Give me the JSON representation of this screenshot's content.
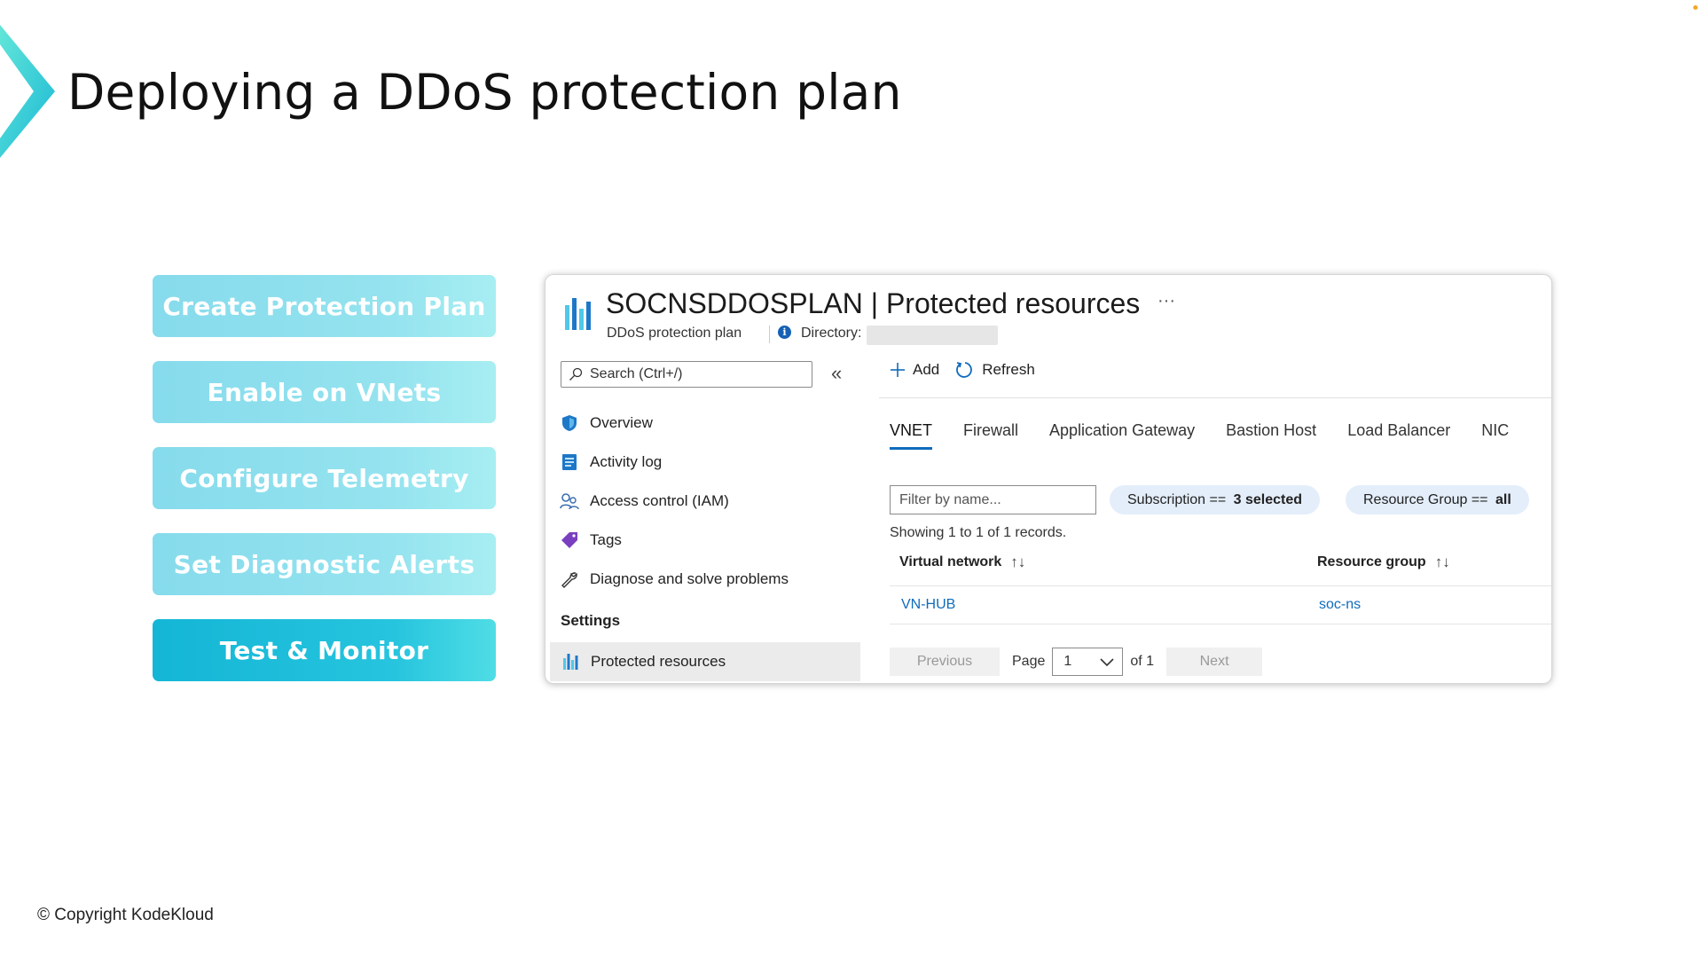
{
  "slide": {
    "title": "Deploying a DDoS protection plan",
    "copyright": "© Copyright KodeKloud",
    "steps": [
      {
        "label": "Create Protection Plan",
        "active": false
      },
      {
        "label": "Enable on VNets",
        "active": false
      },
      {
        "label": "Configure Telemetry",
        "active": false
      },
      {
        "label": "Set Diagnostic Alerts",
        "active": false
      },
      {
        "label": "Test & Monitor",
        "active": true
      }
    ]
  },
  "portal": {
    "resource_name": "SOCNSDDOSPLAN",
    "page_title": "| Protected resources",
    "more": "···",
    "subtitle": "DDoS protection plan",
    "directory_label": "Directory:",
    "search": {
      "placeholder": "Search (Ctrl+/)"
    },
    "collapse_glyph": "«",
    "menu": [
      {
        "label": "Overview",
        "icon": "shield-icon"
      },
      {
        "label": "Activity log",
        "icon": "activity-log-icon"
      },
      {
        "label": "Access control (IAM)",
        "icon": "people-icon"
      },
      {
        "label": "Tags",
        "icon": "tag-icon"
      },
      {
        "label": "Diagnose and solve problems",
        "icon": "wrench-icon"
      }
    ],
    "settings_section": "Settings",
    "active_menu": {
      "label": "Protected resources",
      "icon": "protected-resources-icon"
    },
    "toolbar": {
      "add": "Add",
      "refresh": "Refresh"
    },
    "tabs": [
      "VNET",
      "Firewall",
      "Application Gateway",
      "Bastion Host",
      "Load Balancer",
      "NIC"
    ],
    "active_tab": "VNET",
    "filter": {
      "placeholder": "Filter by name..."
    },
    "pills": {
      "subscription_label": "Subscription == ",
      "subscription_value": "3 selected",
      "resource_group_label": "Resource Group == ",
      "resource_group_value": "all"
    },
    "records_text": "Showing 1 to 1 of 1 records.",
    "table": {
      "columns": [
        "Virtual network",
        "Resource group"
      ],
      "sort_glyph": "↑↓",
      "rows": [
        {
          "virtual_network": "VN-HUB",
          "resource_group": "soc-ns"
        }
      ]
    },
    "pager": {
      "previous": "Previous",
      "page_label": "Page",
      "page_value": "1",
      "of_label": "of 1",
      "next": "Next"
    }
  },
  "colors": {
    "accent": "#0f6cbd",
    "step": "#95e3ef",
    "step_active": "#26c4de",
    "logo": "#2fd0d8"
  }
}
